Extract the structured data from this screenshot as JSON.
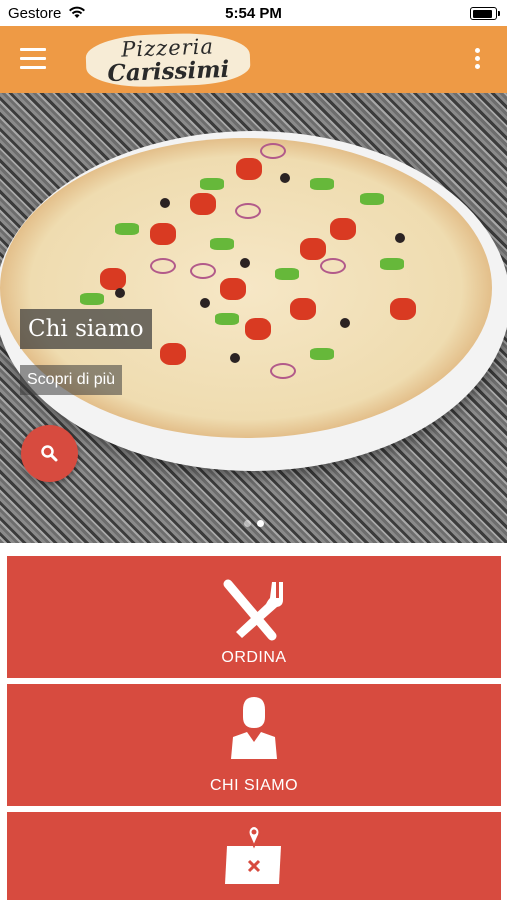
{
  "status_bar": {
    "carrier": "Gestore",
    "time": "5:54 PM",
    "battery_level": 0.9
  },
  "header": {
    "logo_line1": "Pizzeria",
    "logo_line2": "Carissimi",
    "menu_icon": "hamburger-menu-icon",
    "overflow_icon": "kebab-menu-icon"
  },
  "hero": {
    "title": "Chi siamo",
    "link": "Scopri di più",
    "search_icon": "search-icon",
    "slide_count": 2,
    "active_slide": 2
  },
  "tiles": [
    {
      "label": "ORDINA",
      "icon": "fork-knife-icon"
    },
    {
      "label": "CHI SIAMO",
      "icon": "person-icon"
    },
    {
      "label": "",
      "icon": "map-pin-icon"
    }
  ],
  "colors": {
    "header": "#ee9a45",
    "accent": "#d74b3f"
  }
}
